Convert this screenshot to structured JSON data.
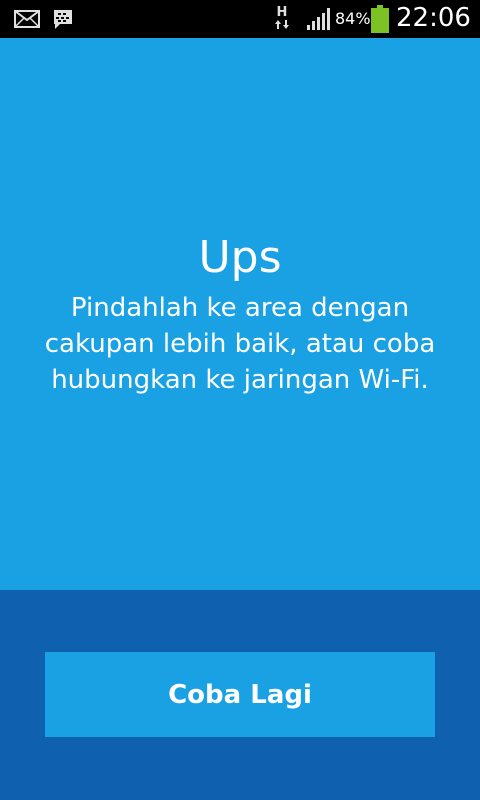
{
  "status_bar": {
    "icons": [
      "mail-icon",
      "bbm-icon",
      "network-type-icon",
      "signal-icon",
      "battery-icon"
    ],
    "network_type": "H",
    "battery_percent": "84%",
    "battery_level": 0.84,
    "time": "22:06"
  },
  "message": {
    "title": "Ups",
    "body": "Pindahlah ke area dengan cakupan lebih baik, atau coba hubungkan ke jaringan Wi-Fi."
  },
  "actions": {
    "retry_label": "Coba Lagi"
  },
  "colors": {
    "primary": "#1aa1e3",
    "panel": "#1060b0",
    "status_bar": "#000000",
    "battery": "#7cc224"
  }
}
